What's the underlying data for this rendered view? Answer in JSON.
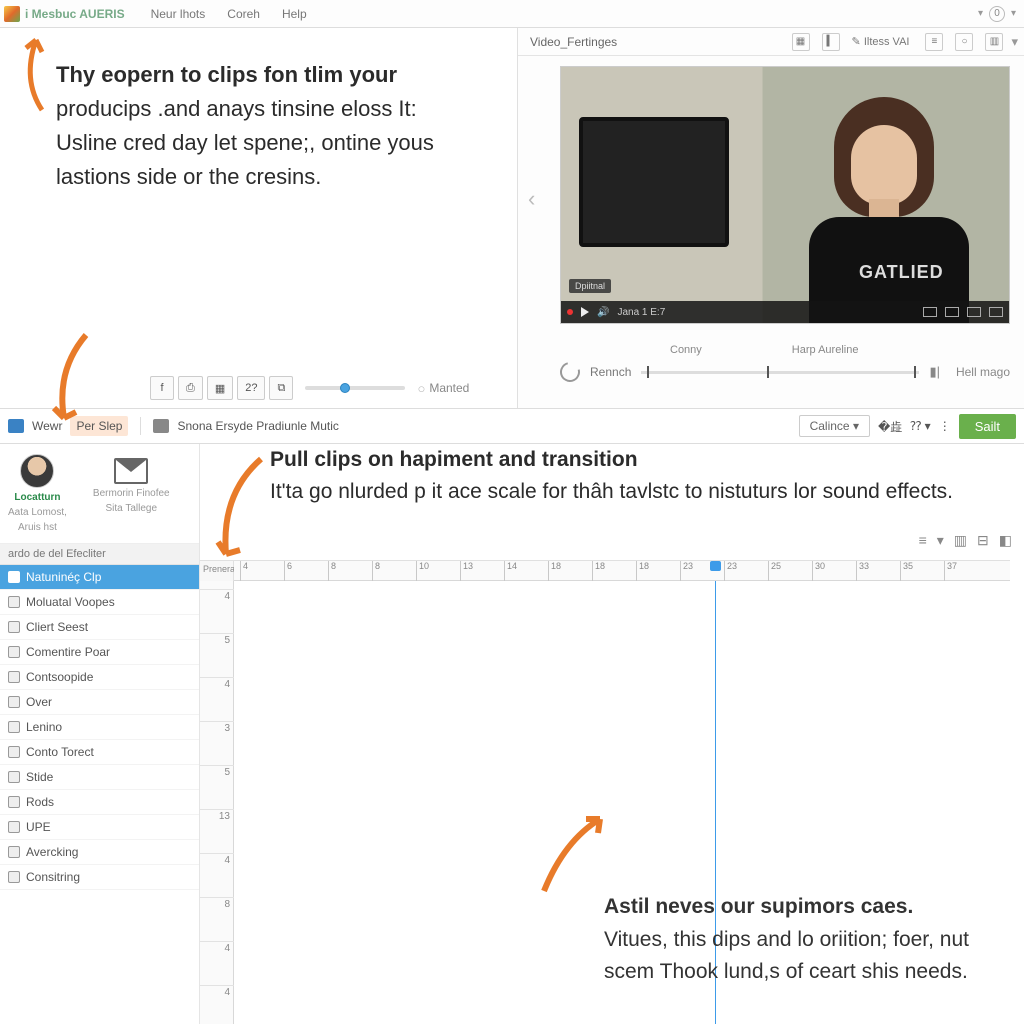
{
  "menubar": {
    "app": "i Mesbuc AUERIS",
    "items": [
      "Neur lhots",
      "Coreh",
      "Help"
    ],
    "counter": "0"
  },
  "video_panel": {
    "tab": "Video_Fertinges",
    "right_label": "Iltess VAI",
    "badge": "Dpiitnal",
    "shirt": "GATLIED",
    "time": "Jana  1 E:7",
    "scrub_left": "Conny",
    "scrub_right": "Harp Aureline",
    "refresh": "Rennch",
    "end": "Hell mago"
  },
  "toolrow": {
    "label": "Manted"
  },
  "annot1": {
    "lead": "Thy eopern to clips fon tlim your",
    "body": "producips .and anays tinsine eloss It: Usline cred day let spene;, ontine yous lastions side or the cresins."
  },
  "midbar": {
    "new": "Wewr",
    "step": "Per Slep",
    "long": "Snona Ersyde Pradiunle Mutic",
    "drop": "Calince",
    "save": "Sailt"
  },
  "profile": {
    "name": "Locatturn",
    "sub1": "Aata Lomost,",
    "sub2": "Aruis hst",
    "mail1": "Bermorin Finofee",
    "mail2": "Sita Tallege"
  },
  "tree": {
    "header": "ardo de del Efecliter",
    "items": [
      "Natuninéç Clp",
      "Moluatal Voopes",
      "Cliert Seest",
      "Comentire Poar",
      "Contsoopide",
      "Over",
      "Lenino",
      "Conto Torect",
      "Stide",
      "Rods",
      "UPE",
      "Avercking",
      "Consitring"
    ]
  },
  "annot2": {
    "lead": "Pull clips on hapiment and transition",
    "body": "It'ta go nlurded p it ace scale for thâh tavlstc to nistuturs lor sound effects."
  },
  "ruler": {
    "corner": "Prenerat",
    "h": [
      "4",
      "6",
      "8",
      "8",
      "10",
      "13",
      "14",
      "18",
      "18",
      "18",
      "23",
      "23",
      "25",
      "30",
      "33",
      "35",
      "37"
    ],
    "v": [
      "4",
      "5",
      "4",
      "3",
      "5",
      "13",
      "4",
      "8",
      "4",
      "4"
    ]
  },
  "annot3": {
    "lead": "Astil neves our supimors caes.",
    "body": "Vitues, this dips and lo oriition; foer, nut scem Thook lund,s of ceart shis needs."
  }
}
